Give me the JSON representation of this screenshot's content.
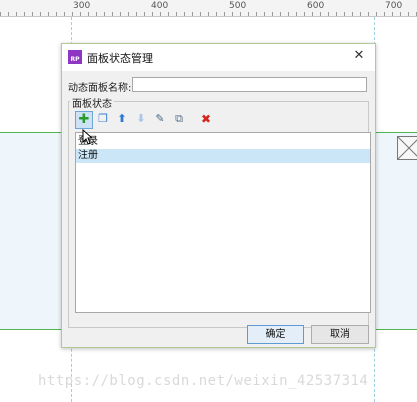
{
  "ruler": {
    "labels": [
      "300",
      "400",
      "500",
      "600",
      "700"
    ]
  },
  "dialog": {
    "title": "面板状态管理",
    "app_icon_text": "RP",
    "close_glyph": "✕",
    "name_label": "动态面板名称:",
    "name_value": "",
    "group_label": "面板状态",
    "toolbar": {
      "add_icon": "plus-icon",
      "copy_icon": "copy-icon",
      "up_icon": "arrow-up-icon",
      "down_icon": "arrow-down-icon",
      "edit_icon": "edit-state-icon",
      "editall_icon": "edit-all-states-icon",
      "delete_icon": "delete-icon"
    },
    "states": [
      {
        "label": "登录",
        "selected": false
      },
      {
        "label": "注册",
        "selected": true
      }
    ],
    "ok_label": "确定",
    "cancel_label": "取消"
  },
  "watermark": "https://blog.csdn.net/weixin_42537314",
  "colors": {
    "panel_border": "#51b44f",
    "panel_fill": "#eef6fb",
    "selection": "#cbe6f7",
    "accent": "#5c9bd4",
    "delete": "#d8261c",
    "add": "#2a9a2a"
  }
}
